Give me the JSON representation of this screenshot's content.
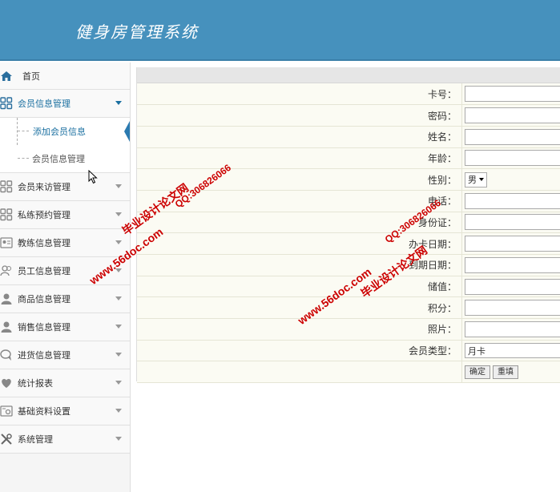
{
  "header": {
    "title": "健身房管理系统"
  },
  "sidebar": {
    "home": "首页",
    "member_menu": "会员信息管理",
    "sub_items": [
      "添加会员信息",
      "会员信息管理"
    ],
    "items": [
      {
        "label": "会员来访管理",
        "icon": "grid-icon"
      },
      {
        "label": "私练预约管理",
        "icon": "grid-icon"
      },
      {
        "label": "教练信息管理",
        "icon": "id-card-icon"
      },
      {
        "label": "员工信息管理",
        "icon": "users-icon"
      },
      {
        "label": "商品信息管理",
        "icon": "user-icon"
      },
      {
        "label": "销售信息管理",
        "icon": "user-icon"
      },
      {
        "label": "进货信息管理",
        "icon": "chat-icon"
      },
      {
        "label": "统计报表",
        "icon": "heart-icon"
      },
      {
        "label": "基础资料设置",
        "icon": "settings-card-icon"
      },
      {
        "label": "系统管理",
        "icon": "tools-icon"
      }
    ]
  },
  "form": {
    "labels": [
      "卡号：",
      "密码：",
      "姓名：",
      "年龄：",
      "性别：",
      "电话：",
      "身份证：",
      "办卡日期：",
      "到期日期：",
      "储值：",
      "积分：",
      "照片：",
      "会员类型："
    ],
    "gender_value": "男",
    "type_value": "月卡",
    "confirm": "确定",
    "reset": "重填"
  },
  "watermark": {
    "site": "www.56doc.com",
    "qq": "QQ:306826066",
    "brand": "毕业设计论文网"
  }
}
